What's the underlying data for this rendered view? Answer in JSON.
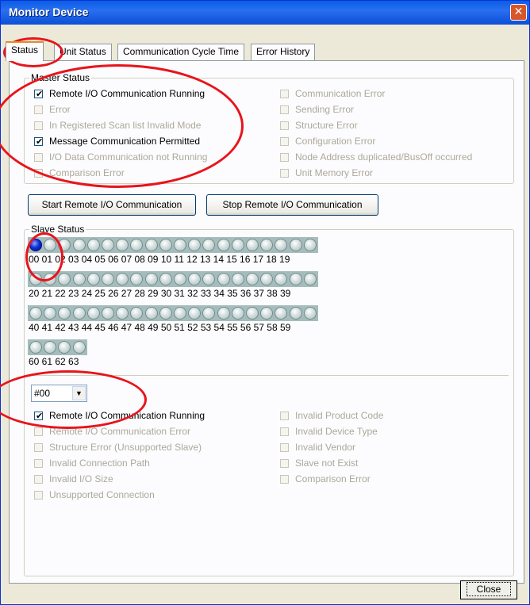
{
  "window": {
    "title": "Monitor Device",
    "close_glyph": "✕"
  },
  "tabs": [
    {
      "label": "Status",
      "active": true
    },
    {
      "label": "Unit Status",
      "active": false
    },
    {
      "label": "Communication Cycle Time",
      "active": false
    },
    {
      "label": "Error History",
      "active": false
    }
  ],
  "master_status": {
    "title": "Master Status",
    "left": [
      {
        "label": "Remote I/O Communication Running",
        "checked": true
      },
      {
        "label": "Error",
        "checked": false
      },
      {
        "label": "In Registered Scan list Invalid Mode",
        "checked": false
      },
      {
        "label": "Message Communication Permitted",
        "checked": true
      },
      {
        "label": "I/O Data Communication not Running",
        "checked": false
      },
      {
        "label": "Comparison Error",
        "checked": false
      }
    ],
    "right": [
      {
        "label": "Communication Error",
        "checked": false
      },
      {
        "label": "Sending Error",
        "checked": false
      },
      {
        "label": "Structure Error",
        "checked": false
      },
      {
        "label": "Configuration Error",
        "checked": false
      },
      {
        "label": "Node Address duplicated/BusOff occurred",
        "checked": false
      },
      {
        "label": "Unit Memory Error",
        "checked": false
      }
    ]
  },
  "buttons": {
    "start": "Start Remote I/O Communication",
    "stop": "Stop Remote I/O Communication",
    "close": "Close"
  },
  "slave_status": {
    "title": "Slave Status",
    "active_nodes": [
      0
    ],
    "rows": [
      "00 01 02 03 04 05 06 07 08 09 10 11 12 13 14 15 16 17 18 19",
      "20 21 22 23 24 25 26 27 28 29 30 31 32 33 34 35 36 37 38 39",
      "40 41 42 43 44 45 46 47 48 49 50 51 52 53 54 55 56 57 58 59",
      "60 61 62 63"
    ],
    "row_counts": [
      20,
      20,
      20,
      4
    ]
  },
  "slave_detail": {
    "selected_node": "#00",
    "left": [
      {
        "label": "Remote I/O Communication Running",
        "checked": true
      },
      {
        "label": "Remote I/O Communication Error",
        "checked": false
      },
      {
        "label": "Structure Error (Unsupported Slave)",
        "checked": false
      },
      {
        "label": "Invalid Connection Path",
        "checked": false
      },
      {
        "label": "Invalid I/O Size",
        "checked": false
      },
      {
        "label": "Unsupported Connection",
        "checked": false
      }
    ],
    "right": [
      {
        "label": "Invalid Product Code",
        "checked": false
      },
      {
        "label": "Invalid Device Type",
        "checked": false
      },
      {
        "label": "Invalid Vendor",
        "checked": false
      },
      {
        "label": "Slave not Exist",
        "checked": false
      },
      {
        "label": "Comparison Error",
        "checked": false
      }
    ]
  },
  "colors": {
    "annotation_ring": "#e8141b",
    "led_active": "#1030d8"
  }
}
